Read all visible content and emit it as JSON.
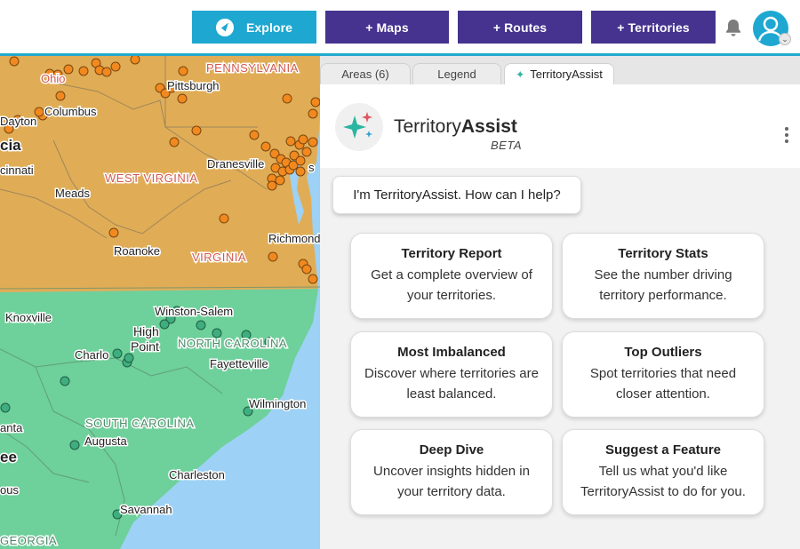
{
  "nav": {
    "explore": "Explore",
    "maps": "+ Maps",
    "routes": "+ Routes",
    "territories": "+ Territories"
  },
  "colors": {
    "accent": "#1ea8d1",
    "nav_purple": "#45338f",
    "territory_north": "#e0ad56",
    "territory_south": "#6ed09a",
    "ocean": "#9dd1f5"
  },
  "icons": {
    "explore": "compass-icon",
    "notifications": "bell-icon",
    "user": "avatar-icon",
    "menu": "kebab-menu-icon",
    "assist": "sparkle-icon"
  },
  "map": {
    "labels": [
      "PENNSYLVANIA",
      "Ohio",
      "Pittsburgh",
      "Columbus",
      "Dayton",
      "cia",
      "cinnati",
      "WEST VIRGINIA",
      "Dranesville",
      "s",
      "Meads",
      "Richmond",
      "Roanoke",
      "VIRGINIA",
      "Knoxville",
      "Winston-Salem",
      "High",
      "Point",
      "NORTH CAROLINA",
      "Charlo",
      "Fayetteville",
      "Wilmington",
      "SOUTH CAROLINA",
      "anta",
      "Augusta",
      "ee",
      "Charleston",
      "ous",
      "Savannah",
      "GEORGIA"
    ]
  },
  "panel": {
    "tabs": {
      "areas": "Areas (6)",
      "legend": "Legend",
      "assist": "TerritoryAssist"
    },
    "brand_light": "Territory",
    "brand_bold": "Assist",
    "beta": "BETA",
    "greeting": "I'm TerritoryAssist. How can I help?",
    "cards": [
      {
        "title": "Territory Report",
        "desc": "Get a complete overview of your territories."
      },
      {
        "title": "Territory Stats",
        "desc": "See the number driving territory performance."
      },
      {
        "title": "Most Imbalanced",
        "desc": "Discover where territories are least balanced."
      },
      {
        "title": "Top Outliers",
        "desc": "Spot territories that need closer attention."
      },
      {
        "title": "Deep Dive",
        "desc": "Uncover insights hidden in your territory data."
      },
      {
        "title": "Suggest a Feature",
        "desc": "Tell us what you'd like TerritoryAssist to do for you."
      }
    ]
  }
}
